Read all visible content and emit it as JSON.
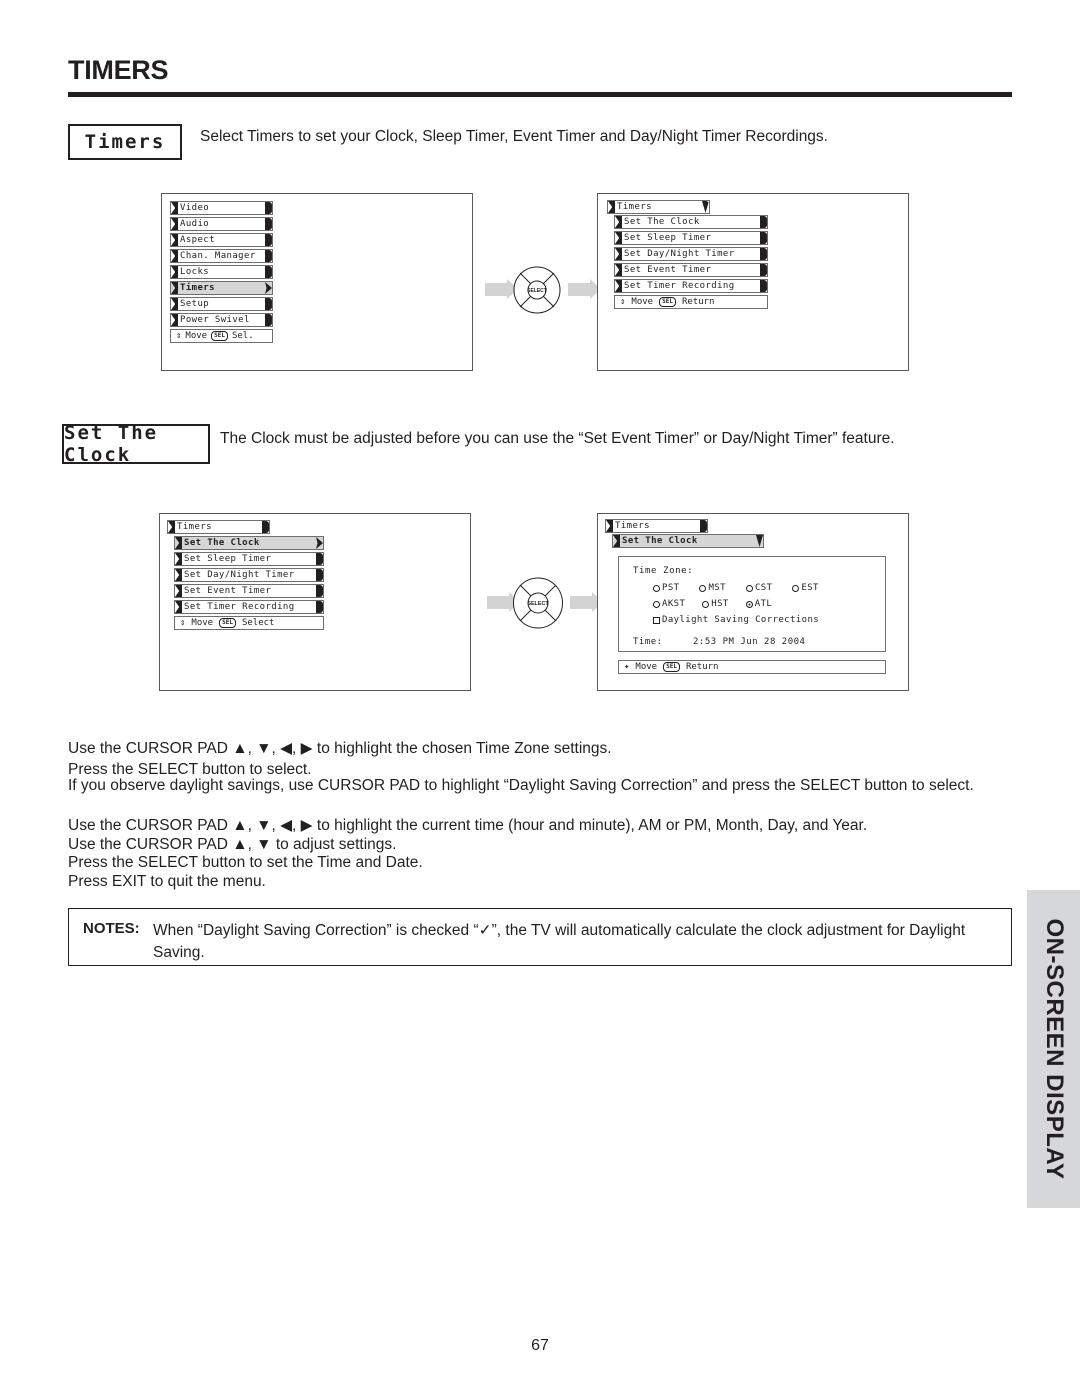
{
  "page": {
    "title": "TIMERS",
    "number": "67",
    "side_tab": "ON-SCREEN DISPLAY"
  },
  "sections": [
    {
      "chip": "Timers",
      "description": "Select Timers to set your Clock, Sleep Timer, Event Timer and Day/Night Timer Recordings."
    },
    {
      "chip": "Set The Clock",
      "description": "The Clock must be adjusted before you can use the “Set Event Timer” or Day/Night Timer” feature."
    }
  ],
  "diagram1": {
    "left_menu": {
      "items": [
        {
          "label": "Video",
          "selected": false
        },
        {
          "label": "Audio",
          "selected": false
        },
        {
          "label": "Aspect",
          "selected": false
        },
        {
          "label": "Chan. Manager",
          "selected": false
        },
        {
          "label": "Locks",
          "selected": false
        },
        {
          "label": "Timers",
          "selected": true
        },
        {
          "label": "Setup",
          "selected": false
        },
        {
          "label": "Power Swivel",
          "selected": false
        }
      ],
      "footer_move": "Move",
      "footer_key": "SEL",
      "footer_action": "Sel."
    },
    "right_menu": {
      "header": "Timers",
      "items": [
        {
          "label": "Set The Clock",
          "selected": false
        },
        {
          "label": "Set Sleep Timer",
          "selected": false
        },
        {
          "label": "Set Day/Night Timer",
          "selected": false
        },
        {
          "label": "Set Event Timer",
          "selected": false
        },
        {
          "label": "Set Timer Recording",
          "selected": false
        }
      ],
      "footer_move": "Move",
      "footer_key": "SEL",
      "footer_action": "Return"
    },
    "pad_label": "SELECT"
  },
  "diagram2": {
    "left_menu": {
      "header": "Timers",
      "items": [
        {
          "label": "Set The Clock",
          "selected": true
        },
        {
          "label": "Set Sleep Timer",
          "selected": false
        },
        {
          "label": "Set Day/Night Timer",
          "selected": false
        },
        {
          "label": "Set Event Timer",
          "selected": false
        },
        {
          "label": "Set Timer Recording",
          "selected": false
        }
      ],
      "footer_move": "Move",
      "footer_key": "SEL",
      "footer_action": "Select"
    },
    "right_panel": {
      "header": "Timers",
      "subheader": "Set The Clock",
      "time_zone_label": "Time Zone:",
      "zones_row1": [
        {
          "label": "PST",
          "selected": false
        },
        {
          "label": "MST",
          "selected": false
        },
        {
          "label": "CST",
          "selected": false
        },
        {
          "label": "EST",
          "selected": false
        }
      ],
      "zones_row2": [
        {
          "label": "AKST",
          "selected": false
        },
        {
          "label": "HST",
          "selected": false
        },
        {
          "label": "ATL",
          "selected": true
        }
      ],
      "daylight_label": "Daylight Saving Corrections",
      "daylight_checked": false,
      "time_label": "Time:",
      "time_value": "2:53 PM Jun 28 2004",
      "footer_move": "Move",
      "footer_key": "SEL",
      "footer_action": "Return"
    },
    "pad_label": "SELECT"
  },
  "instructions": {
    "group1": [
      "Use the CURSOR PAD ▲, ▼, ◀, ▶ to highlight the chosen Time Zone settings.",
      "Press the SELECT button to select.",
      "If you observe daylight savings, use CURSOR PAD to highlight “Daylight Saving Correction” and press the SELECT button to select."
    ],
    "group2": [
      "Use the CURSOR PAD ▲, ▼, ◀, ▶ to highlight the current time (hour and minute), AM or PM, Month, Day, and Year.",
      "Use the CURSOR PAD ▲, ▼ to adjust settings.",
      "Press the SELECT button to set the Time and Date.",
      "Press EXIT to quit the menu."
    ]
  },
  "notes": {
    "label": "NOTES:",
    "text": "When “Daylight Saving Correction” is checked “✓”, the TV will automatically calculate the clock adjustment for Daylight Saving."
  }
}
